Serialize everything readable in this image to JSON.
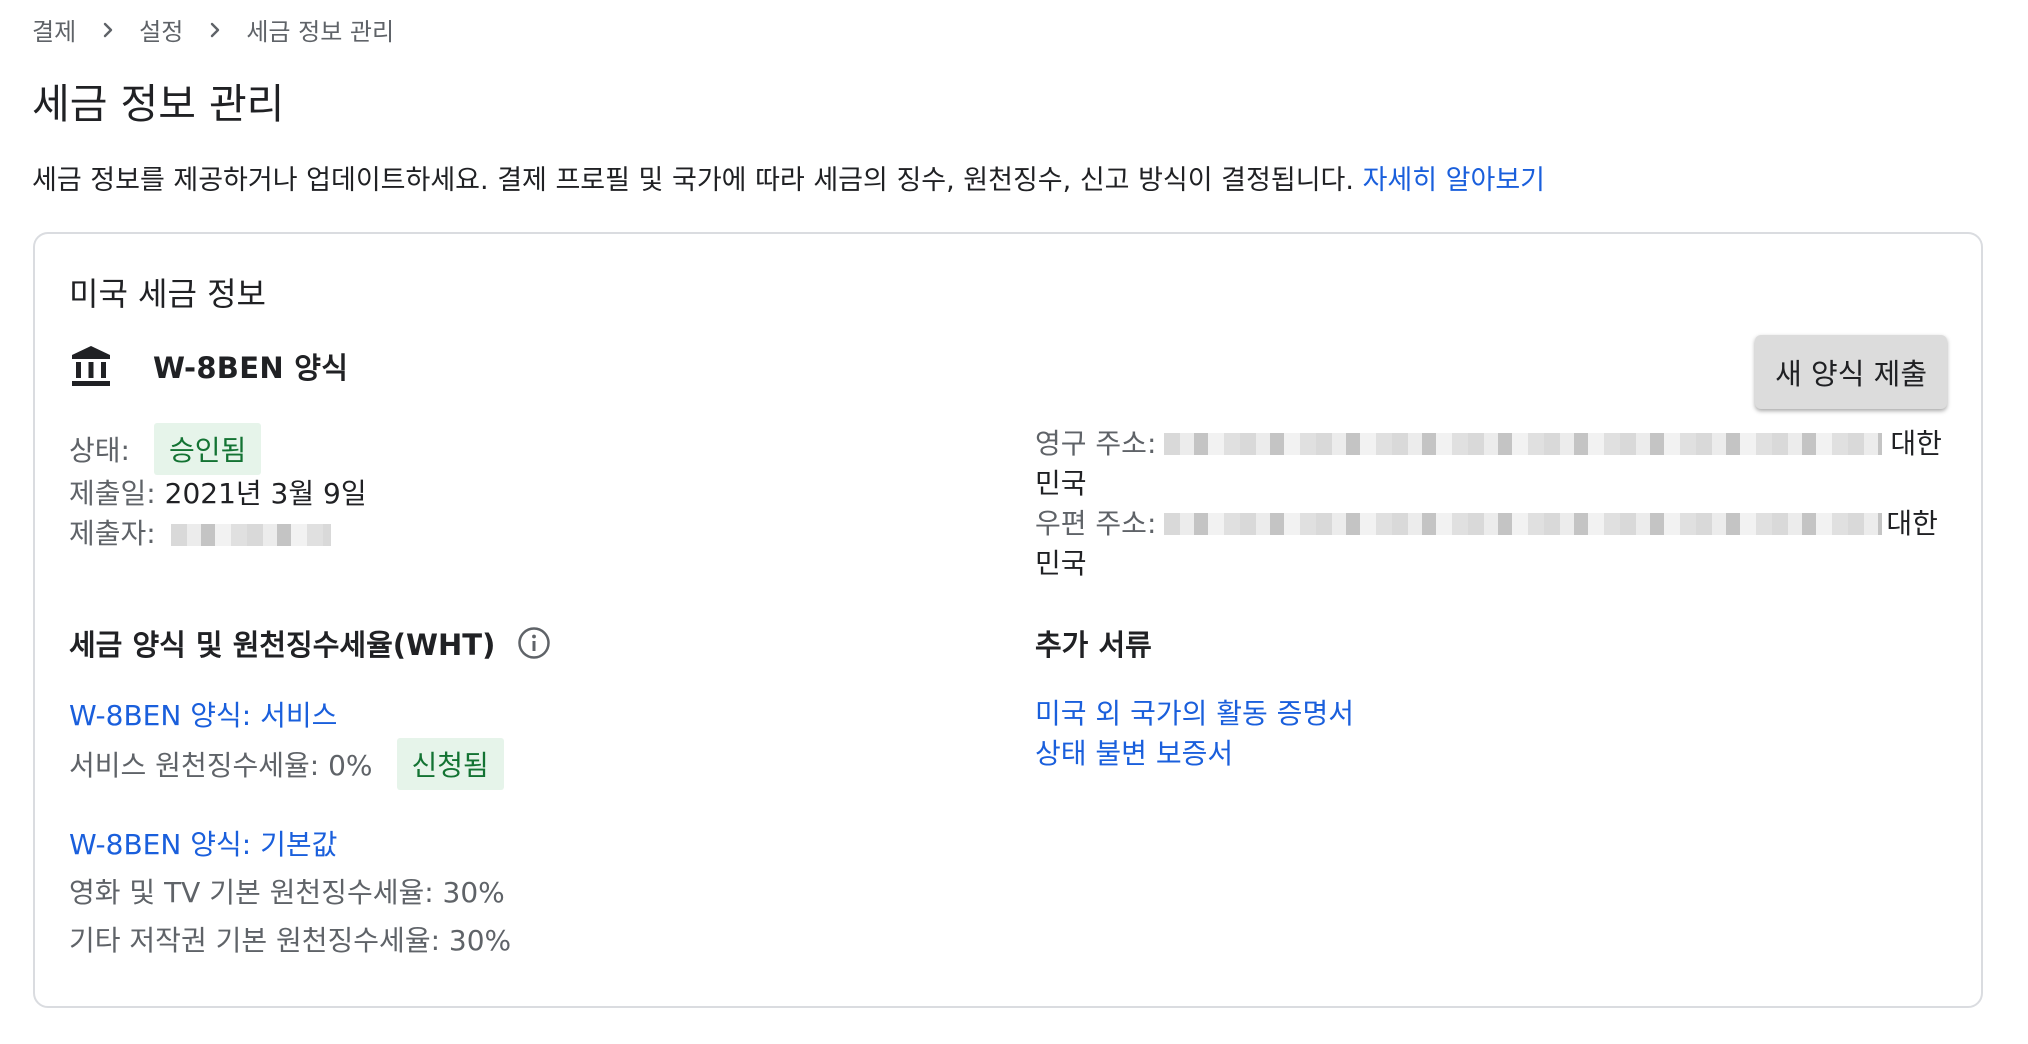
{
  "breadcrumb": {
    "items": [
      "결제",
      "설정",
      "세금 정보 관리"
    ]
  },
  "page": {
    "title": "세금 정보 관리",
    "description": "세금 정보를 제공하거나 업데이트하세요. 결제 프로필 및 국가에 따라 세금의 징수, 원천징수, 신고 방식이 결정됩니다.",
    "learn_more": "자세히 알아보기"
  },
  "card": {
    "title": "미국 세금 정보",
    "form_icon": "bank-icon",
    "form_name": "W-8BEN 양식",
    "submit_button": "새 양식 제출",
    "status_label": "상태:",
    "status_value": "승인됨",
    "submitted_date_label": "제출일:",
    "submitted_date_value": "2021년 3월 9일",
    "submitter_label": "제출자:",
    "permanent_address_label": "영구 주소:",
    "permanent_address_country_1": "대한",
    "permanent_address_country_2": "민국",
    "mailing_address_label": "우편 주소:",
    "mailing_address_country_1": "대한",
    "mailing_address_country_2": "민국",
    "wht_section_title": "세금 양식 및 원천징수세율(WHT)",
    "wht_items": {
      "services_link": "W-8BEN 양식: 서비스",
      "services_rate": "서비스 원천징수세율: 0%",
      "services_chip": "신청됨",
      "default_link": "W-8BEN 양식: 기본값",
      "movies_rate": "영화 및 TV 기본 원천징수세율: 30%",
      "copyright_rate": "기타 저작권 기본 원천징수세율: 30%"
    },
    "extra_docs_title": "추가 서류",
    "extra_docs": {
      "doc1": "미국 외 국가의 활동 증명서",
      "doc2": "상태 불변 보증서"
    }
  },
  "colors": {
    "link": "#1a5fdc",
    "chip_bg": "#e6f4ea",
    "chip_text": "#137333",
    "border": "#dadce0"
  }
}
